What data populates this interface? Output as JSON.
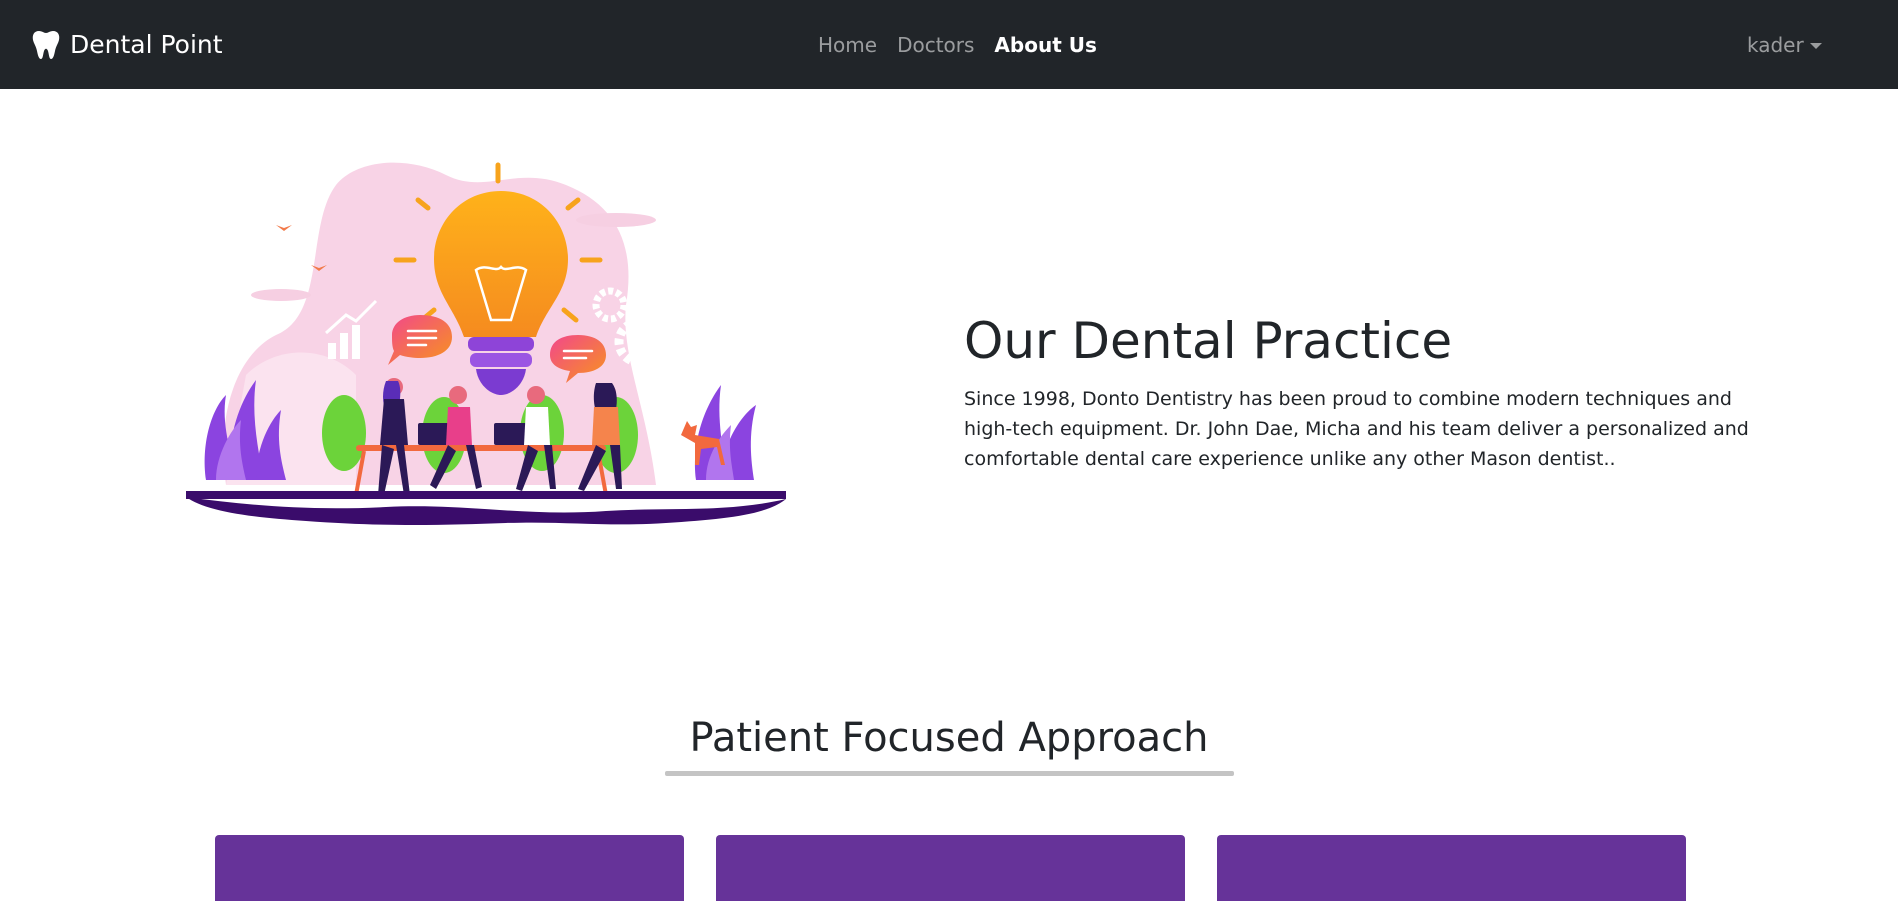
{
  "navbar": {
    "brand": "Dental Point",
    "brand_icon": "tooth-icon",
    "links": [
      {
        "label": "Home",
        "active": false
      },
      {
        "label": "Doctors",
        "active": false
      },
      {
        "label": "About Us",
        "active": true
      }
    ],
    "user": "kader"
  },
  "hero": {
    "title": "Our Dental Practice",
    "text": "Since 1998, Donto Dentistry has been proud to combine modern techniques and high-tech equipment. Dr. John Dae, Micha and his team deliver a personalized and comfortable dental care experience unlike any other Mason dentist.."
  },
  "section": {
    "title": "Patient Focused Approach"
  },
  "colors": {
    "navbar_bg": "#212529",
    "card_bg": "#663399",
    "underline": "#c4c4c4"
  }
}
